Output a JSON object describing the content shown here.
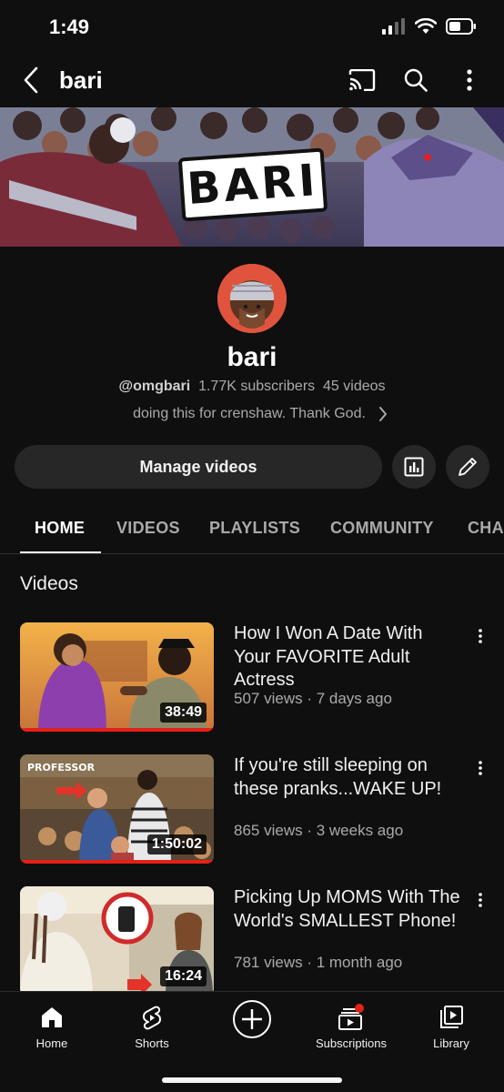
{
  "status_bar": {
    "time": "1:49"
  },
  "topbar": {
    "title": "bari"
  },
  "banner": {
    "word": "BARI"
  },
  "channel": {
    "name": "bari",
    "handle": "@omgbari",
    "subscribers": "1.77K subscribers",
    "videos": "45 videos",
    "description": "doing this for crenshaw. Thank God."
  },
  "actions": {
    "manage_label": "Manage videos"
  },
  "tabs": [
    "HOME",
    "VIDEOS",
    "PLAYLISTS",
    "COMMUNITY",
    "CHA"
  ],
  "section_title": "Videos",
  "videos": [
    {
      "title": "How I Won A Date With Your FAVORITE Adult Actress",
      "views": "507 views",
      "age": "7 days ago",
      "duration": "38:49",
      "progress": 1.0
    },
    {
      "title": "If you're still sleeping on these pranks...WAKE UP!",
      "views": "865 views",
      "age": "3 weeks ago",
      "duration": "1:50:02",
      "progress": 1.0,
      "thumb_label": "PROFESSOR"
    },
    {
      "title": "Picking Up MOMS With The World's SMALLEST Phone!",
      "views": "781 views",
      "age": "1 month ago",
      "duration": "16:24",
      "progress": 0
    }
  ],
  "bottom_nav": {
    "home": "Home",
    "shorts": "Shorts",
    "subscriptions": "Subscriptions",
    "library": "Library"
  },
  "colors": {
    "background": "#0f0f0f",
    "accent_red": "#e52117",
    "button_bg": "#272727"
  }
}
